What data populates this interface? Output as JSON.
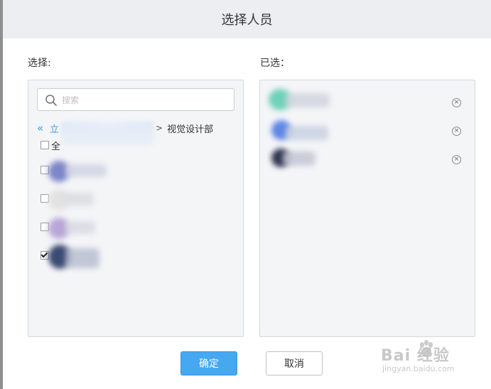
{
  "dialog": {
    "title": "选择人员",
    "left_label": "选择:",
    "right_label": "已选：",
    "ok_label": "确定",
    "cancel_label": "取消"
  },
  "search": {
    "placeholder": "搜索",
    "value": ""
  },
  "breadcrumb": {
    "back_glyph": "«",
    "root_label": "立",
    "separator": ">",
    "current": "视觉设计部"
  },
  "list": {
    "select_all_label": "全",
    "rows": [
      {
        "checked": false,
        "avatar_color": "#7d86c9"
      },
      {
        "checked": false,
        "avatar_color": "#e2e2e2"
      },
      {
        "checked": false,
        "avatar_color": "#b9a6d8"
      },
      {
        "checked": true,
        "avatar_color": "#3b4a72"
      }
    ]
  },
  "selected": [
    {
      "avatar_color": "#6fd1b9",
      "remove_glyph": "×"
    },
    {
      "avatar_color": "#5f86e6",
      "remove_glyph": "×"
    },
    {
      "avatar_color": "#2e3550",
      "remove_glyph": "×"
    }
  ],
  "watermark": {
    "main": "Bai 经验",
    "sub": "jingyan.baidu.com"
  }
}
